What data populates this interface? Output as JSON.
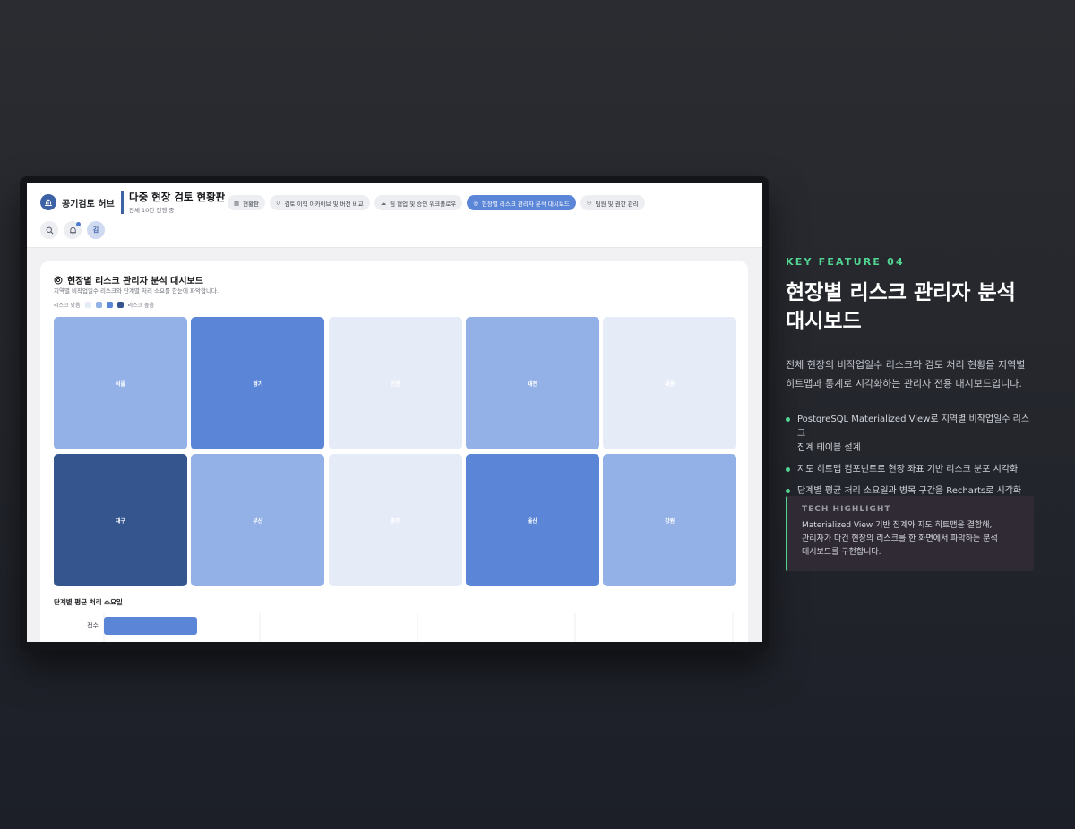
{
  "app": {
    "brand": "공기검토 허브",
    "page_title": "다중 현장 검토 현황판",
    "page_subtitle": "전체 10건 진행 중",
    "nav_tabs": [
      {
        "label": "현황판",
        "icon": "dashboard-icon",
        "active": false
      },
      {
        "label": "검토 이력 아카이브 및 버전 비교",
        "icon": "history-icon",
        "active": false
      },
      {
        "label": "팀 협업 및 승인 워크플로우",
        "icon": "team-icon",
        "active": false
      },
      {
        "label": "현장별 리스크 관리자 분석 대시보드",
        "icon": "analytics-icon",
        "active": true
      },
      {
        "label": "팀원 및 권한 관리",
        "icon": "users-icon",
        "active": false
      }
    ],
    "tools": {
      "search": "search-icon",
      "notification": "bell-icon",
      "avatar_initial": "김"
    }
  },
  "dashboard": {
    "title": "현장별 리스크 관리자 분석 대시보드",
    "subtitle": "지역별 비작업일수 리스크와 단계별 처리 소요를 한눈에 파악합니다.",
    "legend_low": "리스크 낮음",
    "legend_high": "리스크 높음",
    "risk_colors": [
      "#e6ecf7",
      "#93b1e6",
      "#5b86d7",
      "#34558e"
    ],
    "regions": [
      {
        "name": "서울",
        "level": 1
      },
      {
        "name": "경기",
        "level": 2
      },
      {
        "name": "인천",
        "level": 0
      },
      {
        "name": "대전",
        "level": 1
      },
      {
        "name": "세종",
        "level": 0
      },
      {
        "name": "대구",
        "level": 3
      },
      {
        "name": "부산",
        "level": 1
      },
      {
        "name": "광주",
        "level": 0
      },
      {
        "name": "울산",
        "level": 2
      },
      {
        "name": "강원",
        "level": 1
      }
    ],
    "bar_title": "단계별 평균 처리 소요일",
    "bar_rows": [
      {
        "label": "접수"
      }
    ]
  },
  "feature": {
    "kicker": "KEY FEATURE 04",
    "headline_line1": "현장별 리스크 관리자 분석",
    "headline_line2": "대시보드",
    "desc_line1": "전체 현장의 비작업일수 리스크와 검토 처리 현황을 지역별",
    "desc_line2": "히트맵과 통계로 시각화하는 관리자 전용 대시보드입니다.",
    "bullets": [
      {
        "line1": "PostgreSQL Materialized View로 지역별 비작업일수 리스크",
        "line2": "집계 테이블 설계"
      },
      {
        "line1": "지도 히트맵 컴포넌트로 현장 좌표 기반 리스크 분포 시각화",
        "line2": ""
      },
      {
        "line1": "단계별 평균 처리 소요일과 병목 구간을 Recharts로 시각화",
        "line2": ""
      }
    ],
    "tech_label": "TECH HIGHLIGHT",
    "tech_line1": "Materialized View 기반 집계와 지도 히트맵을 결합해,",
    "tech_line2": "관리자가 다건 현장의 리스크를 한 화면에서 파악하는 분석",
    "tech_line3": "대시보드를 구현합니다.",
    "accent_color": "#53d592"
  }
}
